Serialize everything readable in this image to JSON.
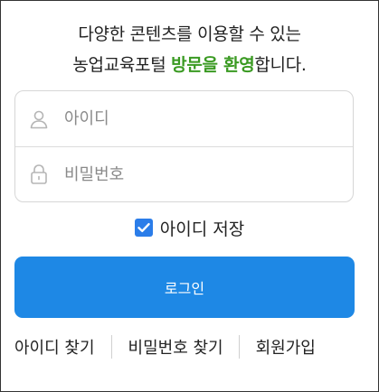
{
  "welcome": {
    "line1": "다양한 콘텐츠를 이용할 수 있는",
    "line2_prefix": "농업교육포털 ",
    "line2_highlight": "방문을 환영",
    "line2_suffix": "합니다."
  },
  "login_form": {
    "id_placeholder": "아이디",
    "password_placeholder": "비밀번호",
    "save_id_label": "아이디 저장",
    "save_id_checked": true,
    "login_button_label": "로그인"
  },
  "links": {
    "find_id": "아이디 찾기",
    "find_password": "비밀번호 찾기",
    "signup": "회원가입"
  },
  "colors": {
    "highlight": "#3a9a22",
    "primary": "#1e88e5",
    "checkbox": "#2b7de9",
    "icon": "#b5b5b5"
  },
  "icons": {
    "id_field": "person-icon",
    "password_field": "lock-icon",
    "checkbox_mark": "checkmark-icon"
  }
}
